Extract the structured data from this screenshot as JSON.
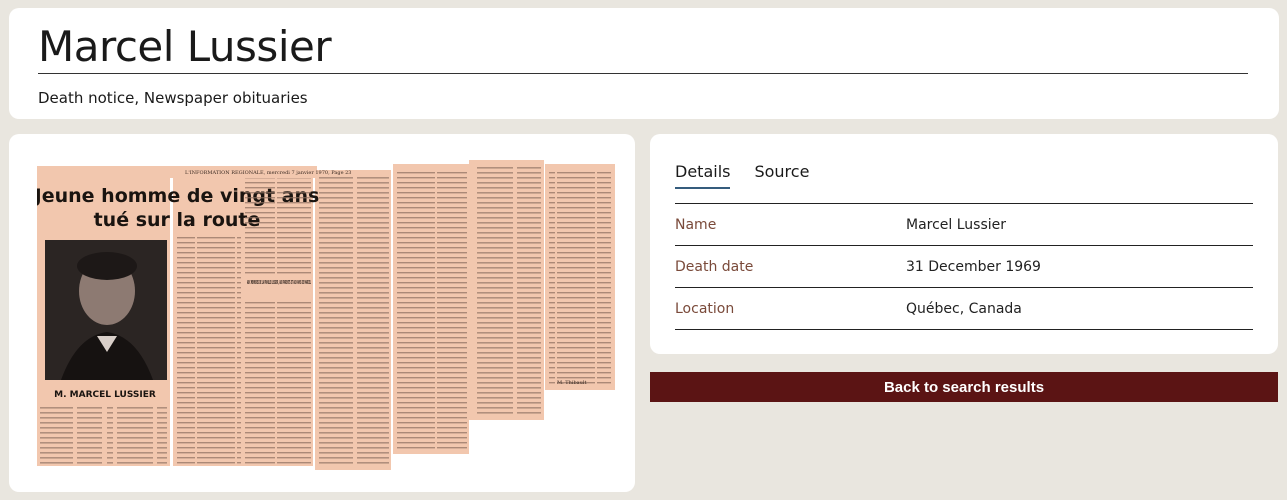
{
  "header": {
    "title": "Marcel Lussier",
    "subtitle": "Death notice, Newspaper obituaries"
  },
  "clipping": {
    "headline_line1": "Jeune homme de vingt ans",
    "headline_line2": "tué sur la route",
    "masthead": "L'INFORMATION REGIONALE, mercredi 7 janvier 1970, Page 23",
    "photo_caption": "M. MARCEL LUSSIER",
    "section_head": "AUX MEMBRES DE LA FAMILLE LUSSIER, AUX PARENTS ET AUX AMIS DE MARCEL",
    "signature": "M. Thibault"
  },
  "details": {
    "tabs": [
      {
        "label": "Details",
        "active": true
      },
      {
        "label": "Source",
        "active": false
      }
    ],
    "rows": [
      {
        "label": "Name",
        "value": "Marcel Lussier"
      },
      {
        "label": "Death date",
        "value": "31 December 1969"
      },
      {
        "label": "Location",
        "value": "Québec, Canada"
      }
    ]
  },
  "back_button": {
    "label": "Back to search results"
  },
  "colors": {
    "page_bg": "#e9e6df",
    "card_bg": "#ffffff",
    "label_color": "#7a4a3a",
    "button_bg": "#5b1414",
    "tab_underline": "#355c7d",
    "paper": "#f2c7ae"
  }
}
